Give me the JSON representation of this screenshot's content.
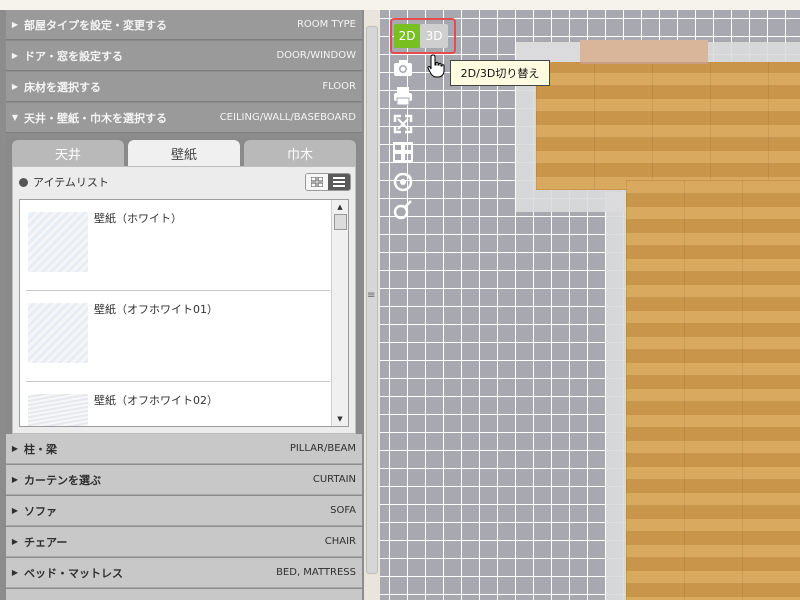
{
  "accordion_top": [
    {
      "jp": "部屋タイプを設定・変更する",
      "en": "ROOM TYPE",
      "expanded": false
    },
    {
      "jp": "ドア・窓を設定する",
      "en": "DOOR/WINDOW",
      "expanded": false
    },
    {
      "jp": "床材を選択する",
      "en": "FLOOR",
      "expanded": false
    },
    {
      "jp": "天井・壁紙・巾木を選択する",
      "en": "CEILING/WALL/BASEBOARD",
      "expanded": true
    }
  ],
  "tabs": [
    {
      "label": "天井",
      "active": false
    },
    {
      "label": "壁紙",
      "active": true
    },
    {
      "label": "巾木",
      "active": false
    }
  ],
  "item_list": {
    "title": "アイテムリスト",
    "items": [
      {
        "name": "壁紙（ホワイト）"
      },
      {
        "name": "壁紙（オフホワイト01）"
      },
      {
        "name": "壁紙（オフホワイト02）"
      }
    ]
  },
  "accordion_bottom": [
    {
      "jp": "柱・梁",
      "en": "PILLAR/BEAM"
    },
    {
      "jp": "カーテンを選ぶ",
      "en": "CURTAIN"
    },
    {
      "jp": "ソファ",
      "en": "SOFA"
    },
    {
      "jp": "チェアー",
      "en": "CHAIR"
    },
    {
      "jp": "ベッド・マットレス",
      "en": "BED, MATTRESS"
    }
  ],
  "view_toggle": {
    "label_2d": "2D",
    "label_3d": "3D",
    "active": "2D"
  },
  "tooltip": "2D/3D切り替え",
  "toolbar_icons": [
    "camera-icon",
    "print-icon",
    "fullscreen-icon",
    "grid-view-icon",
    "rotate-icon",
    "zoom-icon"
  ],
  "colors": {
    "active_green": "#78c021",
    "highlight_red": "#e34c4c",
    "tooltip_bg": "#fffbe1"
  }
}
